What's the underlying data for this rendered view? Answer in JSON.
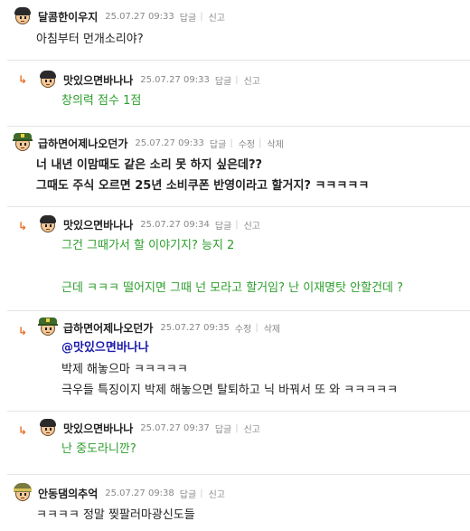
{
  "comments": [
    {
      "author": "달콤한이우지",
      "date": "25.07.27 09:33",
      "actions": [
        "답글",
        "신고"
      ],
      "lines": [
        "아침부터 먼개소리야?"
      ]
    },
    {
      "author": "맛있으면바나나",
      "date": "25.07.27 09:33",
      "actions": [
        "답글",
        "신고"
      ],
      "lines": [
        "창의력 점수 1점"
      ]
    },
    {
      "author": "급하면어제나오던가",
      "date": "25.07.27 09:33",
      "actions": [
        "답글",
        "수정",
        "삭제"
      ],
      "lines": [
        "너 내년 이맘때도 같은 소리 못 하지 싶은데??",
        "그때도 주식 오르면 25년 소비쿠폰 반영이라고 할거지? ㅋㅋㅋㅋㅋ"
      ]
    },
    {
      "author": "맛있으면바나나",
      "date": "25.07.27 09:34",
      "actions": [
        "답글",
        "신고"
      ],
      "lines": [
        "그건 그때가서 할 이야기지? 능지 2",
        "근데 ㅋㅋㅋ 떨어지면 그때 넌 모라고 할거임? 난 이재명탓 안할건데 ?"
      ]
    },
    {
      "author": "급하면어제나오던가",
      "date": "25.07.27 09:35",
      "actions": [
        "수정",
        "삭제"
      ],
      "mention": "@맛있으면바나나",
      "lines": [
        "박제 해놓으마 ㅋㅋㅋㅋㅋ",
        "극우들 특징이지 박제 해놓으면 탈퇴하고 닉 바꿔서 또 와 ㅋㅋㅋㅋㅋ"
      ]
    },
    {
      "author": "맛있으면바나나",
      "date": "25.07.27 09:37",
      "actions": [
        "답글",
        "신고"
      ],
      "lines": [
        "난 중도라니깐?"
      ]
    },
    {
      "author": "안동댐의추억",
      "date": "25.07.27 09:38",
      "actions": [
        "답글",
        "신고"
      ],
      "lines": [
        "ㅋㅋㅋㅋ 정말 찢팔러마광신도들"
      ]
    }
  ],
  "colors": {
    "reply_text": "#2c9e2c",
    "mention": "#1a1aaa",
    "reply_arrow": "#e8702a"
  },
  "icons": {
    "reply_arrow": "reply-arrow-icon"
  }
}
